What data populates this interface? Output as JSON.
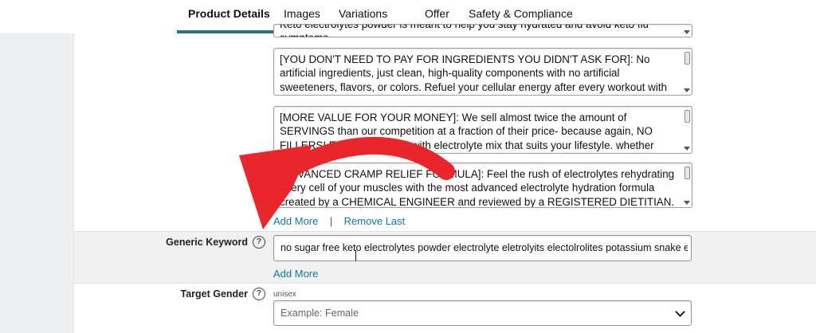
{
  "tabs": {
    "product_details": "Product Details",
    "images": "Images",
    "variations": "Variations",
    "offer": "Offer",
    "safety": "Safety & Compliance"
  },
  "bullets": {
    "top_clipped": "Keto electrolytes powder is meant to help you stay hydrated and avoid keto flu symptoms.",
    "b1": "[YOU DON'T NEED TO PAY FOR INGREDIENTS YOU DIDN'T ASK FOR]: No artificial ingredients, just clean, high-quality components with no artificial sweeteners, flavors, or colors. Refuel your cellular energy after every workout with all the essential vitamins and minerals electrolytes your body needs to perform at a high level",
    "b2": "[MORE VALUE FOR YOUR MONEY]: We sell almost twice the amount of SERVINGS than our competition at a fraction of their price- because again, NO FILLERS! Enrich your body with electrolyte mix that suits your lifestyle. whether your diet is keto or not, electrolytes are needed with essential minerals needed for healthy diet",
    "b3": "[ADVANCED CRAMP RELIEF FORMULA]: Feel the rush of electrolytes rehydrating every cell of your muscles with the most advanced electrolyte hydration formula created by a CHEMICAL ENGINEER and reviewed by a REGISTERED DIETITIAN. Also known as keto electrolytes powder to help with dehydration"
  },
  "bullet_links": {
    "add_more": "Add More",
    "remove_last": "Remove Last",
    "separator": "|"
  },
  "generic_keyword": {
    "label": "Generic Keyword",
    "value": "no sugar free keto electrolytes powder electrolyte eletrolyits electolrolites potassium snake elctrolit",
    "add_more": "Add More",
    "help": "?"
  },
  "target_gender": {
    "label": "Target Gender",
    "hint": "unisex",
    "placeholder": "Example: Female",
    "help": "?"
  },
  "colors": {
    "accent": "#2f6f7e",
    "link": "#0f7a98",
    "annotation_arrow": "#e8262b"
  },
  "icons": {
    "help": "question-circle-icon",
    "dropdown": "chevron-down-icon",
    "annotation": "curved-arrow-icon"
  }
}
